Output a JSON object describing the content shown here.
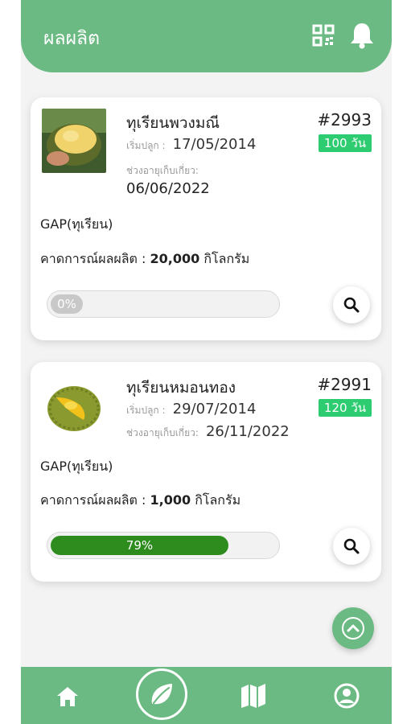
{
  "header": {
    "title": "ผลผลิต",
    "icons": [
      "qr-code-icon",
      "bell-icon"
    ]
  },
  "cards": [
    {
      "name": "ทุเรียนพวงมณี",
      "lot": "#2993",
      "days_badge": "100 วัน",
      "plant_label": "เริ่มปลูก :",
      "plant_date": "17/05/2014",
      "harvest_label": "ช่วงอายุเก็บเกี่ยว:",
      "harvest_date": "06/06/2022",
      "standard": "GAP(ทุเรียน)",
      "estimate_label": "คาดการณ์ผลผลิต :",
      "estimate_value": "20,000",
      "estimate_unit": "กิโลกรัม",
      "progress": 0,
      "progress_text": "0%"
    },
    {
      "name": "ทุเรียนหมอนทอง",
      "lot": "#2991",
      "days_badge": "120 วัน",
      "plant_label": "เริ่มปลูก :",
      "plant_date": "29/07/2014",
      "harvest_label": "ช่วงอายุเก็บเกี่ยว:",
      "harvest_date": "26/11/2022",
      "standard": "GAP(ทุเรียน)",
      "estimate_label": "คาดการณ์ผลผลิต :",
      "estimate_value": "1,000",
      "estimate_unit": "กิโลกรัม",
      "progress": 0.79,
      "progress_text": "79%"
    }
  ],
  "colors": {
    "primary": "#6cba83",
    "badge": "#2ecc71",
    "progress_fill": "#2e8b1e"
  },
  "bottom_nav": {
    "items": [
      "home-icon",
      "leaf-icon",
      "map-icon",
      "profile-icon"
    ]
  }
}
